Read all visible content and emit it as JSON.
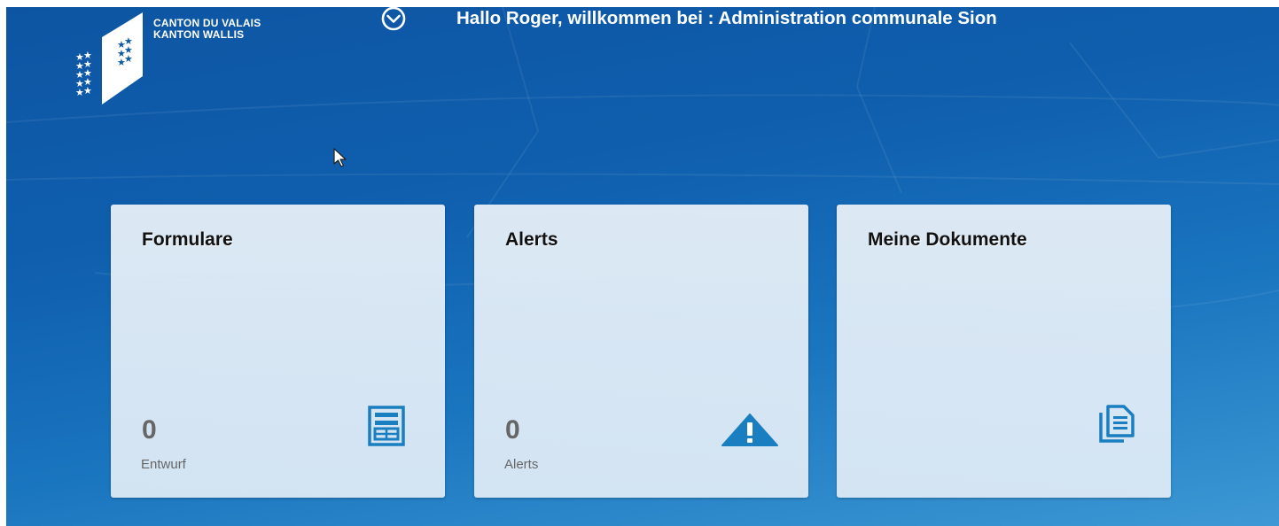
{
  "header": {
    "logo_line1": "CANTON DU VALAIS",
    "logo_line2": "KANTON WALLIS",
    "logo_icon": "valais-coat-of-arms-icon",
    "menu_icon": "chevron-down-circle-icon",
    "welcome_text": "Hallo Roger, willkommen bei : Administration communale Sion"
  },
  "tiles": [
    {
      "title": "Formulare",
      "count": "0",
      "subtitle": "Entwurf",
      "icon": "form-icon"
    },
    {
      "title": "Alerts",
      "count": "0",
      "subtitle": "Alerts",
      "icon": "warning-icon"
    },
    {
      "title": "Meine Dokumente",
      "icon": "documents-icon"
    }
  ],
  "colors": {
    "background_top": "#0d55a3",
    "background_bottom": "#3d98d4",
    "accent_icon": "#1a7fc0",
    "tile_text": "#111111",
    "tile_muted": "#666666"
  }
}
